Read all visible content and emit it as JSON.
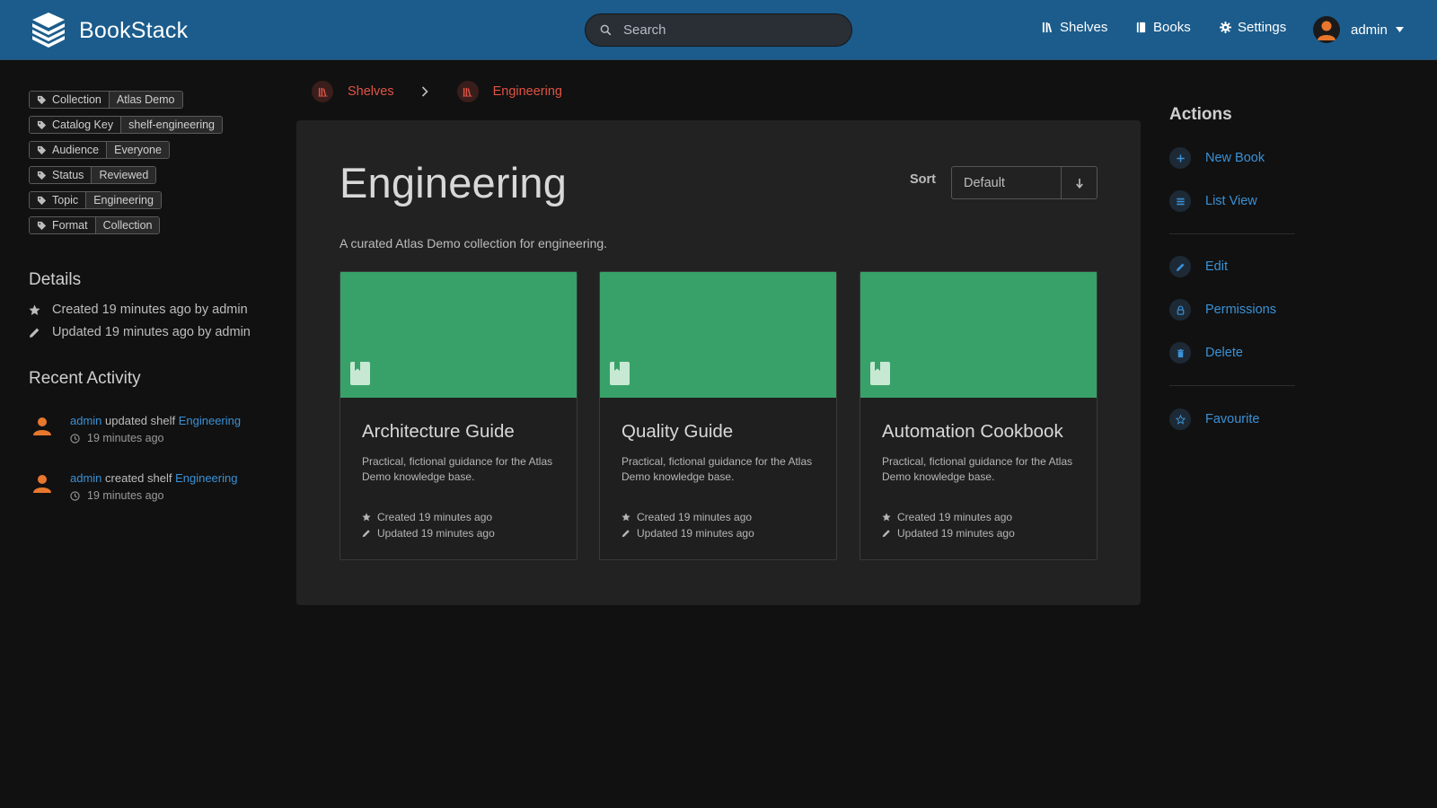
{
  "app": {
    "name": "BookStack"
  },
  "search": {
    "placeholder": "Search"
  },
  "nav": {
    "shelves": "Shelves",
    "books": "Books",
    "settings": "Settings",
    "user": "admin"
  },
  "tags": [
    {
      "name": "Collection",
      "value": "Atlas Demo"
    },
    {
      "name": "Catalog Key",
      "value": "shelf-engineering"
    },
    {
      "name": "Audience",
      "value": "Everyone"
    },
    {
      "name": "Status",
      "value": "Reviewed"
    },
    {
      "name": "Topic",
      "value": "Engineering"
    },
    {
      "name": "Format",
      "value": "Collection"
    }
  ],
  "details": {
    "title": "Details",
    "created": "Created 19 minutes ago by admin",
    "updated": "Updated 19 minutes ago by admin"
  },
  "recent_activity": {
    "title": "Recent Activity",
    "items": [
      {
        "user": "admin",
        "action": " updated shelf ",
        "target": "Engineering",
        "time": "19 minutes ago"
      },
      {
        "user": "admin",
        "action": " created shelf ",
        "target": "Engineering",
        "time": "19 minutes ago"
      }
    ]
  },
  "breadcrumb": [
    {
      "label": "Shelves"
    },
    {
      "label": "Engineering"
    }
  ],
  "shelf": {
    "title": "Engineering",
    "description": "A curated Atlas Demo collection for engineering.",
    "sort_label": "Sort",
    "sort_value": "Default"
  },
  "books": [
    {
      "title": "Architecture Guide",
      "description": "Practical, fictional guidance for the Atlas Demo knowledge base.",
      "created": "Created 19 minutes ago",
      "updated": "Updated 19 minutes ago"
    },
    {
      "title": "Quality Guide",
      "description": "Practical, fictional guidance for the Atlas Demo knowledge base.",
      "created": "Created 19 minutes ago",
      "updated": "Updated 19 minutes ago"
    },
    {
      "title": "Automation Cookbook",
      "description": "Practical, fictional guidance for the Atlas Demo knowledge base.",
      "created": "Created 19 minutes ago",
      "updated": "Updated 19 minutes ago"
    }
  ],
  "actions": {
    "title": "Actions",
    "new_book": "New Book",
    "list_view": "List View",
    "edit": "Edit",
    "permissions": "Permissions",
    "delete": "Delete",
    "favourite": "Favourite"
  },
  "colors": {
    "header": "#1b5c8c",
    "shelf_accent": "#e05345",
    "book_cover": "#38a169",
    "link": "#3b91d6",
    "background": "#111111",
    "card": "#222222"
  }
}
